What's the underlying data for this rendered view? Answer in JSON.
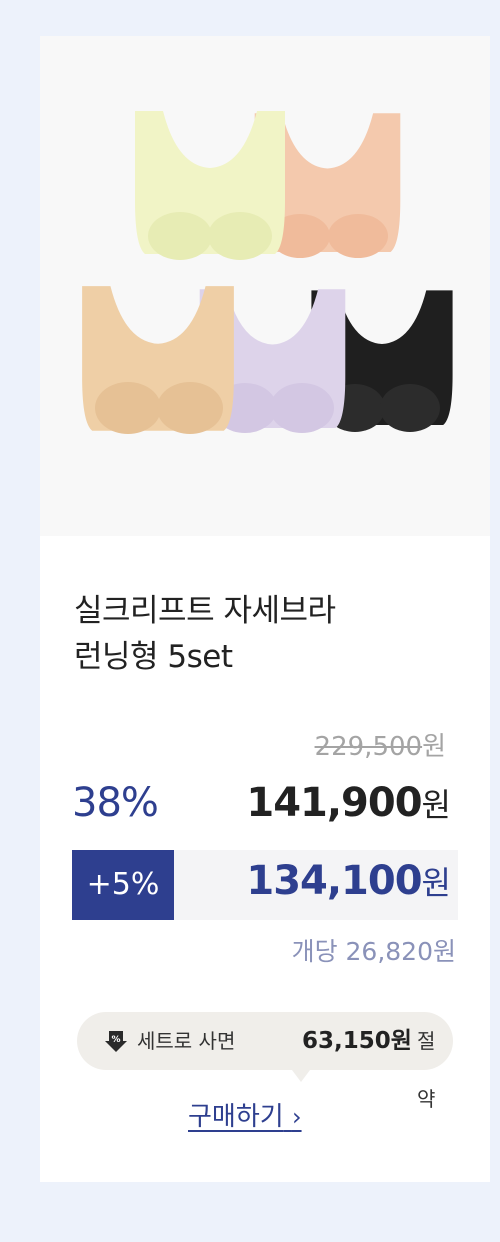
{
  "product": {
    "title_line1": "실크리프트 자세브라",
    "title_line2": "런닝형 5set",
    "image_alt": "5 color tank bras"
  },
  "pricing": {
    "original_price": "229,500",
    "original_unit": "원",
    "discount_rate": "38%",
    "sale_price": "141,900",
    "sale_unit": "원",
    "extra_discount": "+5%",
    "coupon_price": "134,100",
    "coupon_unit": "원",
    "per_unit": "개당 26,820원"
  },
  "savings": {
    "icon": "percent-down-icon",
    "label": "세트로 사면",
    "amount": "63,150원",
    "suffix": "절약"
  },
  "cta": {
    "label": "구매하기",
    "chevron": "›"
  },
  "colors": {
    "accent": "#2e3f8f",
    "background": "#edf2fb",
    "product_colors": [
      "#f2f4c8",
      "#f4c9ad",
      "#efcfa6",
      "#dcd2e8",
      "#1e1e1e"
    ]
  }
}
